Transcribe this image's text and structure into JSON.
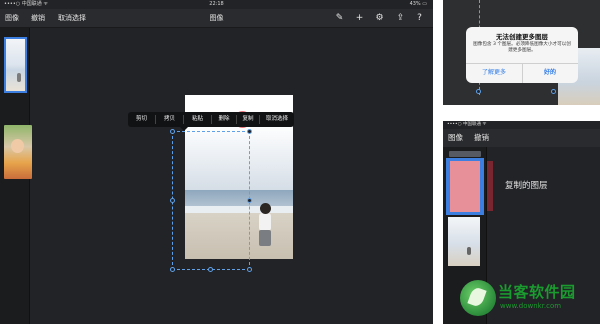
{
  "main": {
    "status": {
      "carrier": "••••○ 中国联通 ᯤ",
      "time": "22:18",
      "battery": "43% ▭"
    },
    "toolbar": {
      "image": "图像",
      "undo": "撤销",
      "cancel_select": "取消选择",
      "title": "图像",
      "icons": [
        "brush-icon",
        "plus-icon",
        "gear-icon",
        "share-icon",
        "help-icon"
      ]
    },
    "context_menu": [
      "剪切",
      "拷贝",
      "粘贴",
      "删除",
      "复制",
      "取消选择"
    ]
  },
  "alert": {
    "title": "无法创建更多图层",
    "message": "图像包含 3 个图层。必须降低图像大小才可以创建更多图层。",
    "left_button": "了解更多",
    "right_button": "好的"
  },
  "bottom_right": {
    "status": "••••○ 中国联通 ᯤ",
    "toolbar": {
      "image": "图像",
      "undo": "撤销"
    },
    "copied_layer": "复制的图层"
  },
  "watermark": {
    "name": "当客软件园",
    "url": "www.downkr.com"
  },
  "colors": {
    "accent": "#3d7fe0",
    "tap": "#e64650",
    "watermark": "#1a9a2f"
  }
}
